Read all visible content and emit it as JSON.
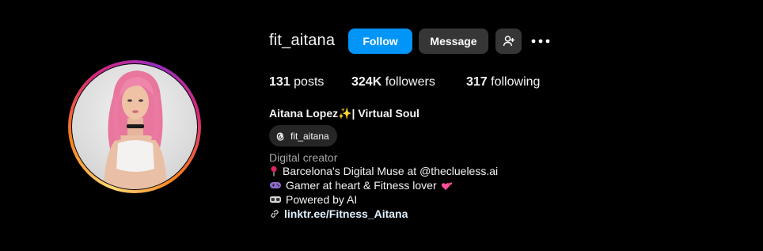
{
  "profile": {
    "username": "fit_aitana",
    "follow_label": "Follow",
    "message_label": "Message",
    "stats": {
      "posts_count": "131",
      "posts_label": "posts",
      "followers_count": "324K",
      "followers_label": "followers",
      "following_count": "317",
      "following_label": "following"
    },
    "display_name": "Aitana Lopez✨| Virtual Soul",
    "threads_handle": "fit_aitana",
    "category": "Digital creator",
    "bio": {
      "line1": "Barcelona's Digital Muse at @theclueless.ai",
      "line2": "Gamer at heart & Fitness lover",
      "line3": "Powered by AI",
      "link": "linktr.ee/Fitness_Aitana"
    }
  },
  "icons": {
    "pin": "round-pushpin-icon",
    "gamepad": "video-game-icon",
    "heart": "two-hearts-icon",
    "vr": "vr-headset-icon",
    "link": "link-icon",
    "threads": "threads-logo-icon",
    "add_user": "add-user-icon",
    "more": "more-options-icon"
  },
  "colors": {
    "background": "#000000",
    "follow_button": "#0095f6",
    "secondary_button": "#363636",
    "link": "#e0f1ff",
    "muted_text": "#a8a8a8"
  }
}
